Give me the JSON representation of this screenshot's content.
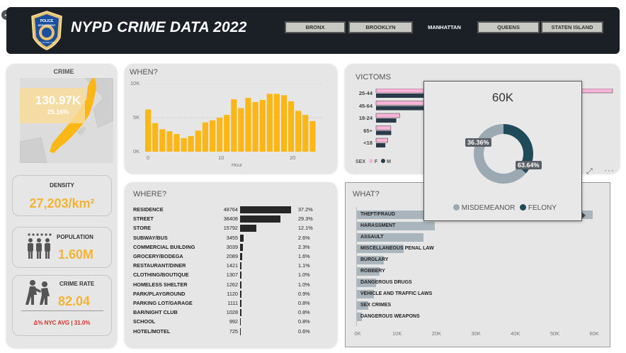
{
  "header": {
    "title": "NYPD CRIME DATA 2022",
    "boroughs": [
      {
        "label": "BRONX",
        "active": false
      },
      {
        "label": "BROOKLYN",
        "active": false
      },
      {
        "label": "MANHATTAN",
        "active": true
      },
      {
        "label": "QUEENS",
        "active": false
      },
      {
        "label": "STATEN ISLAND",
        "active": false
      }
    ],
    "logo": {
      "line1": "POLICE",
      "line2": "DEPARTMENT",
      "line3": "CITY OF NEW YORK"
    }
  },
  "crime_card": {
    "title": "CRIME",
    "value": "130.97K",
    "share": "25.16%",
    "map_icon": "manhattan-map"
  },
  "density": {
    "label": "DENSITY",
    "value": "27,203/km²"
  },
  "population": {
    "label": "POPULATION",
    "value": "1.60M",
    "icon": "people-group-icon"
  },
  "crime_rate": {
    "label": "CRIME RATE",
    "value": "82.04",
    "delta": "Δ% NYC AVG | 31.0%",
    "icon": "arrest-icon"
  },
  "when": {
    "title": "WHEN?",
    "y_ticks": [
      "10K",
      "5K",
      "0K"
    ],
    "x_ticks": [
      "0",
      "10",
      "20"
    ],
    "xlabel": "Hour"
  },
  "where": {
    "title": "WHERE?",
    "rows": [
      {
        "label": "RESIDENCE",
        "count": "48764",
        "pct": "37.2%"
      },
      {
        "label": "STREET",
        "count": "38408",
        "pct": "29.3%"
      },
      {
        "label": "STORE",
        "count": "15792",
        "pct": "12.1%"
      },
      {
        "label": "SUBWAY/BUS",
        "count": "3455",
        "pct": "2.6%"
      },
      {
        "label": "COMMERCIAL BUILDING",
        "count": "3039",
        "pct": "2.3%"
      },
      {
        "label": "GROCERY/BODEGA",
        "count": "2089",
        "pct": "1.6%"
      },
      {
        "label": "RESTAURANT/DINER",
        "count": "1421",
        "pct": "1.1%"
      },
      {
        "label": "CLOTHING/BOUTIQUE",
        "count": "1307",
        "pct": "1.0%"
      },
      {
        "label": "HOMELESS SHELTER",
        "count": "1262",
        "pct": "1.0%"
      },
      {
        "label": "PARK/PLAYGROUND",
        "count": "1120",
        "pct": "0.9%"
      },
      {
        "label": "PARKING LOT/GARAGE",
        "count": "1111",
        "pct": "0.8%"
      },
      {
        "label": "BAR/NIGHT CLUB",
        "count": "1028",
        "pct": "0.8%"
      },
      {
        "label": "SCHOOL",
        "count": "992",
        "pct": "0.8%"
      },
      {
        "label": "HOTEL/MOTEL",
        "count": "725",
        "pct": "0.6%"
      }
    ]
  },
  "victims": {
    "title": "VICTOMS",
    "legend_prefix": "SEX",
    "legend_f": "F",
    "legend_m": "M"
  },
  "what": {
    "title": "WHAT?"
  },
  "tooltip": {
    "value": "60K",
    "labels": [
      "36.36%",
      "63.64%"
    ],
    "legend": [
      "MISDEMEANOR",
      "FELONY"
    ],
    "colors": [
      "#9aa9b2",
      "#1e4a5a"
    ]
  },
  "chart_data": [
    {
      "type": "bar",
      "title": "WHEN?",
      "xlabel": "Hour",
      "ylabel": "",
      "x": [
        0,
        1,
        2,
        3,
        4,
        5,
        6,
        7,
        8,
        9,
        10,
        11,
        12,
        13,
        14,
        15,
        16,
        17,
        18,
        19,
        20,
        21,
        22,
        23
      ],
      "values": [
        6200,
        4200,
        3300,
        3000,
        2600,
        2000,
        2300,
        3100,
        4300,
        4600,
        5000,
        5400,
        7700,
        6400,
        7900,
        7300,
        7600,
        8500,
        8500,
        8300,
        7400,
        6000,
        5400,
        4500
      ],
      "ylim": [
        0,
        10000
      ],
      "color": "#fcb714"
    },
    {
      "type": "bar",
      "title": "VICTOMS",
      "categories": [
        "25-44",
        "45-64",
        "18-24",
        "65+",
        "<18"
      ],
      "series": [
        {
          "name": "F",
          "color": "#f7b4d8",
          "values": [
            28000,
            7000,
            2800,
            1750,
            1400
          ]
        },
        {
          "name": "M",
          "color": "#2b3a4a",
          "values": [
            22000,
            9000,
            2400,
            1800,
            1100
          ]
        }
      ]
    },
    {
      "type": "bar",
      "title": "WHAT?",
      "categories": [
        "THEFT/FRAUD",
        "HARASSMENT",
        "ASSAULT",
        "MISCELLANEOUS PENAL LAW",
        "BURGLARY",
        "ROBBERY",
        "DANGEROUS DRUGS",
        "VEHICLE AND TRAFFIC LAWS",
        "SEX CRIMES",
        "DANGEROUS WEAPONS"
      ],
      "values": [
        60000,
        20000,
        17000,
        12000,
        7000,
        6000,
        5000,
        4500,
        3000,
        1500
      ],
      "x_ticks": [
        "0K",
        "10K",
        "20K",
        "30K",
        "40K",
        "50K",
        "60K"
      ],
      "xlim": [
        0,
        60000
      ]
    },
    {
      "type": "pie",
      "title": "60K",
      "categories": [
        "MISDEMEANOR",
        "FELONY"
      ],
      "values": [
        63.64,
        36.36
      ]
    }
  ]
}
